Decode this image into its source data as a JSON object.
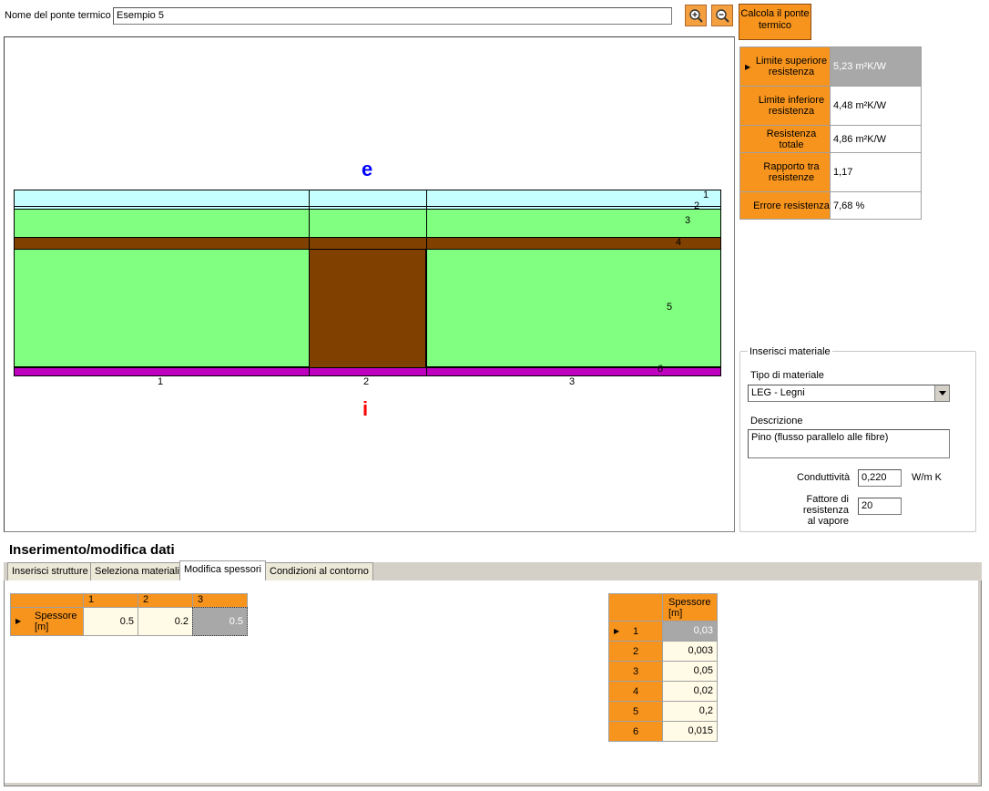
{
  "header": {
    "name_label": "Nome del ponte termico",
    "name_value": "Esempio 5",
    "calc_button": "Calcola il ponte termico"
  },
  "results": [
    {
      "label": "Limite superiore resistenza",
      "value": "5,23 m²K/W"
    },
    {
      "label": "Limite inferiore resistenza",
      "value": "4,48 m²K/W"
    },
    {
      "label": "Resistenza totale",
      "value": "4,86 m²K/W"
    },
    {
      "label": "Rapporto tra resistenze",
      "value": "1,17"
    },
    {
      "label": "Errore resistenza",
      "value": "7,68 %"
    }
  ],
  "drawing": {
    "ext_label": "e",
    "int_label": "i",
    "layer_numbers": [
      "1",
      "2",
      "3",
      "4",
      "5",
      "6"
    ],
    "column_numbers": [
      "1",
      "2",
      "3"
    ],
    "colors": {
      "cyan": "#c6ffff",
      "green": "#80ff80",
      "brown": "#804000",
      "magenta": "#c000c0",
      "ext": "#0000ff",
      "int": "#ff0000"
    }
  },
  "material": {
    "group_title": "Inserisci materiale",
    "type_label": "Tipo di materiale",
    "type_value": "LEG - Legni",
    "desc_label": "Descrizione",
    "desc_value": "Pino (flusso parallelo alle fibre)",
    "cond_label": "Conduttività",
    "cond_value": "0,220",
    "cond_unit": "W/m K",
    "vapor_label_1": "Fattore di resistenza",
    "vapor_label_2": "al vapore",
    "vapor_value": "20"
  },
  "section_title": "Inserimento/modifica dati",
  "tabs": [
    "Inserisci strutture",
    "Seleziona materiali",
    "Modifica spessori",
    "Condizioni al contorno"
  ],
  "col_table": {
    "headers": [
      "1",
      "2",
      "3"
    ],
    "row_label_1": "Spessore",
    "row_label_2": "[m]",
    "values": [
      "0.5",
      "0.2",
      "0.5"
    ]
  },
  "layer_table": {
    "header_1": "Spessore",
    "header_2": "[m]",
    "rows": [
      {
        "n": "1",
        "v": "0,03"
      },
      {
        "n": "2",
        "v": "0,003"
      },
      {
        "n": "3",
        "v": "0,05"
      },
      {
        "n": "4",
        "v": "0,02"
      },
      {
        "n": "5",
        "v": "0,2"
      },
      {
        "n": "6",
        "v": "0,015"
      }
    ]
  }
}
